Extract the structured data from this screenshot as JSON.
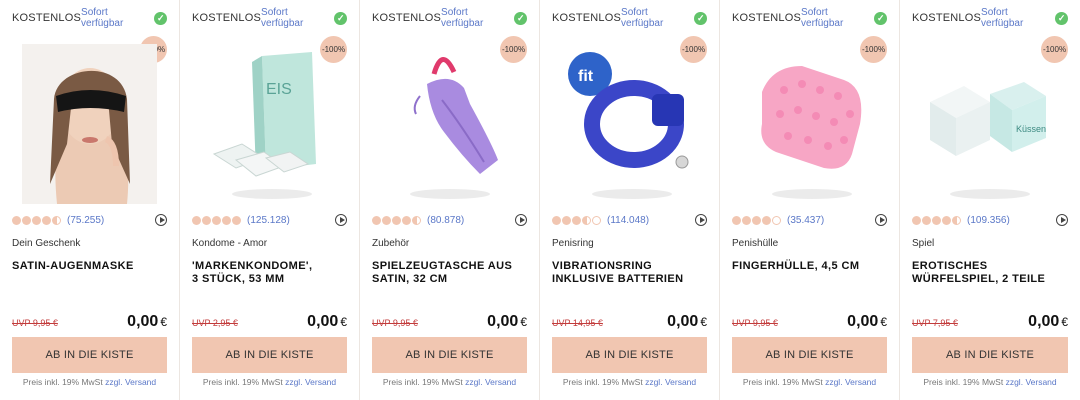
{
  "products": [
    {
      "tag": "KOSTENLOS",
      "availability": "Sofort verfügbar",
      "discount": "-100%",
      "image_icon": "sleep-mask-image",
      "stars": [
        1,
        1,
        1,
        1,
        0.5
      ],
      "reviews": "(75.255)",
      "category": "Dein Geschenk",
      "title_lines": [
        "SATIN-AUGENMASKE",
        ""
      ],
      "uvp": "UVP 9,95 €",
      "price": "0,00",
      "currency": "€",
      "button": "AB IN DIE KISTE",
      "vat_prefix": "Preis inkl. 19% MwSt",
      "vat_zzgl": "zzgl.",
      "vat_link": "Versand"
    },
    {
      "tag": "KOSTENLOS",
      "availability": "Sofort verfügbar",
      "discount": "-100%",
      "image_icon": "condom-box-image",
      "box_text": "EIS",
      "stars": [
        1,
        1,
        1,
        1,
        1
      ],
      "reviews": "(125.128)",
      "category": "Kondome - Amor",
      "title_lines": [
        "'MARKENKONDOME',",
        "3 STÜCK, 53 MM"
      ],
      "uvp": "UVP 2,95 €",
      "price": "0,00",
      "currency": "€",
      "button": "AB IN DIE KISTE",
      "vat_prefix": "Preis inkl. 19% MwSt",
      "vat_zzgl": "zzgl.",
      "vat_link": "Versand"
    },
    {
      "tag": "KOSTENLOS",
      "availability": "Sofort verfügbar",
      "discount": "-100%",
      "image_icon": "satin-bag-image",
      "stars": [
        1,
        1,
        1,
        1,
        0.5
      ],
      "reviews": "(80.878)",
      "category": "Zubehör",
      "title_lines": [
        "SPIELZEUGTASCHE AUS",
        "SATIN, 32 CM"
      ],
      "uvp": "UVP 9,95 €",
      "price": "0,00",
      "currency": "€",
      "button": "AB IN DIE KISTE",
      "vat_prefix": "Preis inkl. 19% MwSt",
      "vat_zzgl": "zzgl.",
      "vat_link": "Versand"
    },
    {
      "tag": "KOSTENLOS",
      "availability": "Sofort verfügbar",
      "discount": "-100%",
      "image_icon": "vibrating-ring-image",
      "stars": [
        1,
        1,
        1,
        0.5,
        0
      ],
      "reviews": "(114.048)",
      "category": "Penisring",
      "title_lines": [
        "VIBRATIONSRING",
        "INKLUSIVE BATTERIEN"
      ],
      "uvp": "UVP 14,95 €",
      "price": "0,00",
      "currency": "€",
      "button": "AB IN DIE KISTE",
      "vat_prefix": "Preis inkl. 19% MwSt",
      "vat_zzgl": "zzgl.",
      "vat_link": "Versand"
    },
    {
      "tag": "KOSTENLOS",
      "availability": "Sofort verfügbar",
      "discount": "-100%",
      "image_icon": "finger-sleeve-image",
      "stars": [
        1,
        1,
        1,
        1,
        0
      ],
      "reviews": "(35.437)",
      "category": "Penishülle",
      "title_lines": [
        "FINGERHÜLLE, 4,5 CM",
        ""
      ],
      "uvp": "UVP 9,95 €",
      "price": "0,00",
      "currency": "€",
      "button": "AB IN DIE KISTE",
      "vat_prefix": "Preis inkl. 19% MwSt",
      "vat_zzgl": "zzgl.",
      "vat_link": "Versand"
    },
    {
      "tag": "KOSTENLOS",
      "availability": "Sofort verfügbar",
      "discount": "-100%",
      "image_icon": "dice-image",
      "dice_text": "Küssen",
      "stars": [
        1,
        1,
        1,
        1,
        0.5
      ],
      "reviews": "(109.356)",
      "category": "Spiel",
      "title_lines": [
        "EROTISCHES",
        "WÜRFELSPIEL, 2 TEILE"
      ],
      "uvp": "UVP 7,95 €",
      "price": "0,00",
      "currency": "€",
      "button": "AB IN DIE KISTE",
      "vat_prefix": "Preis inkl. 19% MwSt",
      "vat_zzgl": "zzgl.",
      "vat_link": "Versand"
    }
  ]
}
